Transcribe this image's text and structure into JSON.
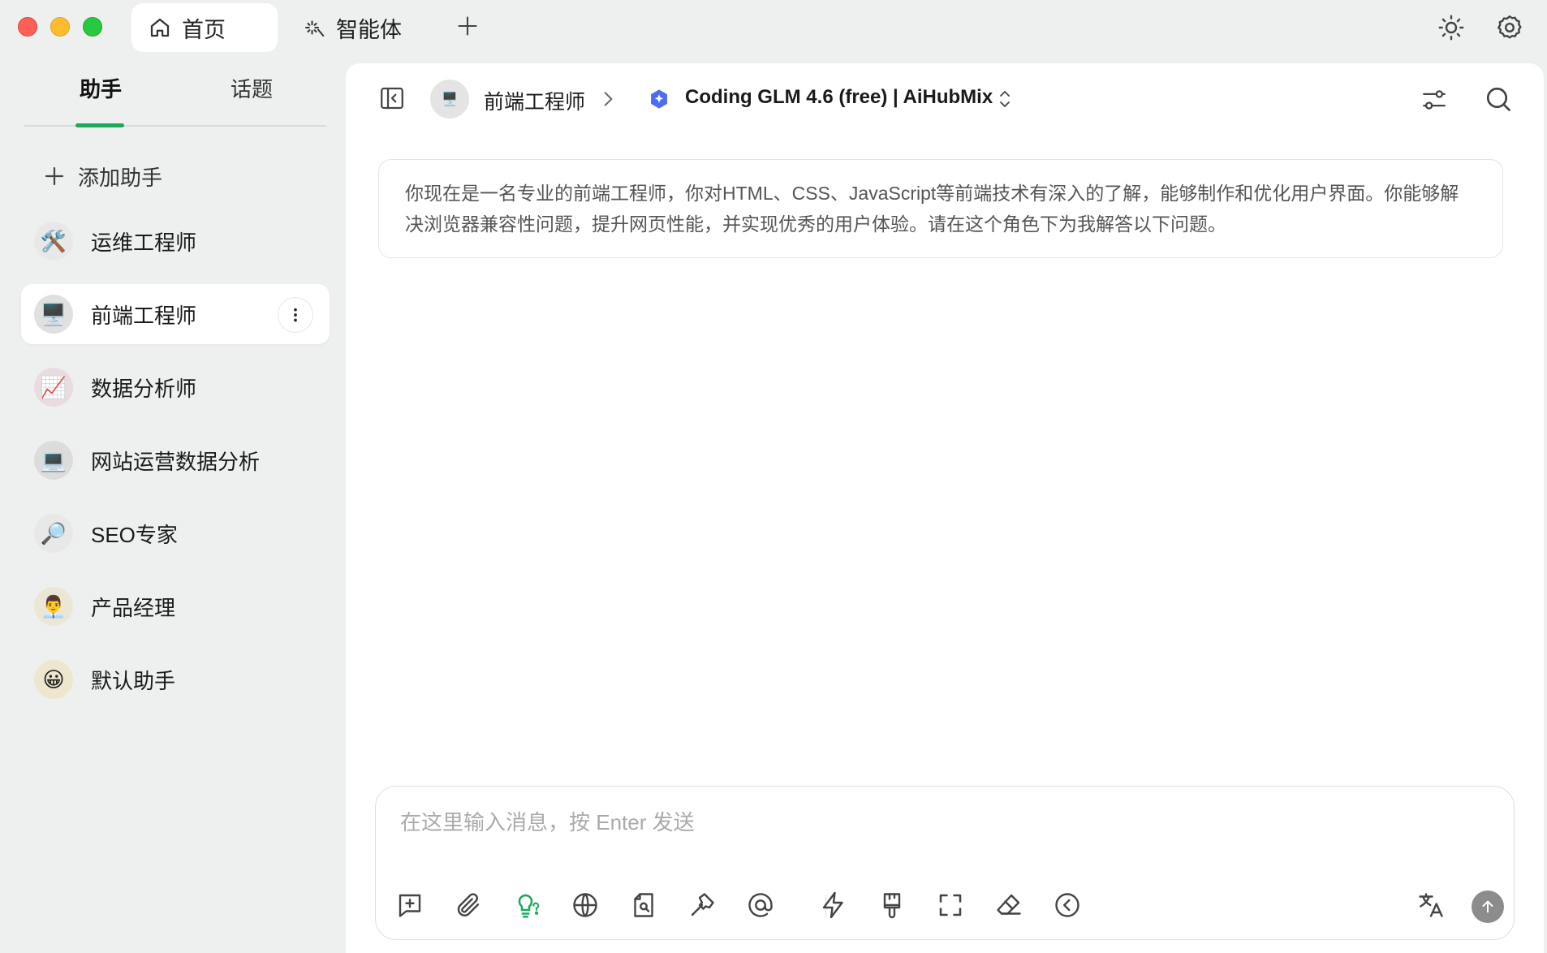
{
  "titlebar": {
    "tabs": [
      {
        "label": "首页",
        "icon": "home-icon",
        "active": true
      },
      {
        "label": "智能体",
        "icon": "sparkle-icon",
        "active": false
      }
    ],
    "add_tab_icon": "plus-icon",
    "right_icons": [
      "sun-icon",
      "gear-icon"
    ]
  },
  "sidebar": {
    "segments": [
      {
        "label": "助手",
        "active": true
      },
      {
        "label": "话题",
        "active": false
      }
    ],
    "accent_color": "#1fa85b",
    "add_label": "添加助手",
    "assistants": [
      {
        "name": "运维工程师",
        "avatar": "🛠️",
        "active": false
      },
      {
        "name": "前端工程师",
        "avatar": "🖥️",
        "active": true
      },
      {
        "name": "数据分析师",
        "avatar": "📈",
        "active": false
      },
      {
        "name": "网站运营数据分析",
        "avatar": "💻",
        "active": false
      },
      {
        "name": "SEO专家",
        "avatar": "🔎",
        "active": false
      },
      {
        "name": "产品经理",
        "avatar": "👨‍💼",
        "active": false
      },
      {
        "name": "默认助手",
        "avatar": "😀",
        "active": false
      }
    ]
  },
  "header": {
    "assistant_name": "前端工程师",
    "assistant_avatar": "🖥️",
    "model_name": "Coding GLM 4.6 (free) | AiHubMix",
    "model_icon_color": "#4a6cf7"
  },
  "prompt": {
    "text": "你现在是一名专业的前端工程师，你对HTML、CSS、JavaScript等前端技术有深入的了解，能够制作和优化用户界面。你能够解决浏览器兼容性问题，提升网页性能，并实现优秀的用户体验。请在这个角色下为我解答以下问题。"
  },
  "composer": {
    "placeholder": "在这里输入消息，按 Enter 发送",
    "tools": [
      "new-topic-icon",
      "attachment-icon",
      "thinking-icon",
      "web-search-icon",
      "knowledge-icon",
      "tools-icon",
      "mention-icon",
      "quick-phrase-icon",
      "paint-icon",
      "expand-icon",
      "clear-icon",
      "collapse-icon"
    ],
    "right_tools": [
      "translate-icon",
      "send-icon"
    ]
  }
}
